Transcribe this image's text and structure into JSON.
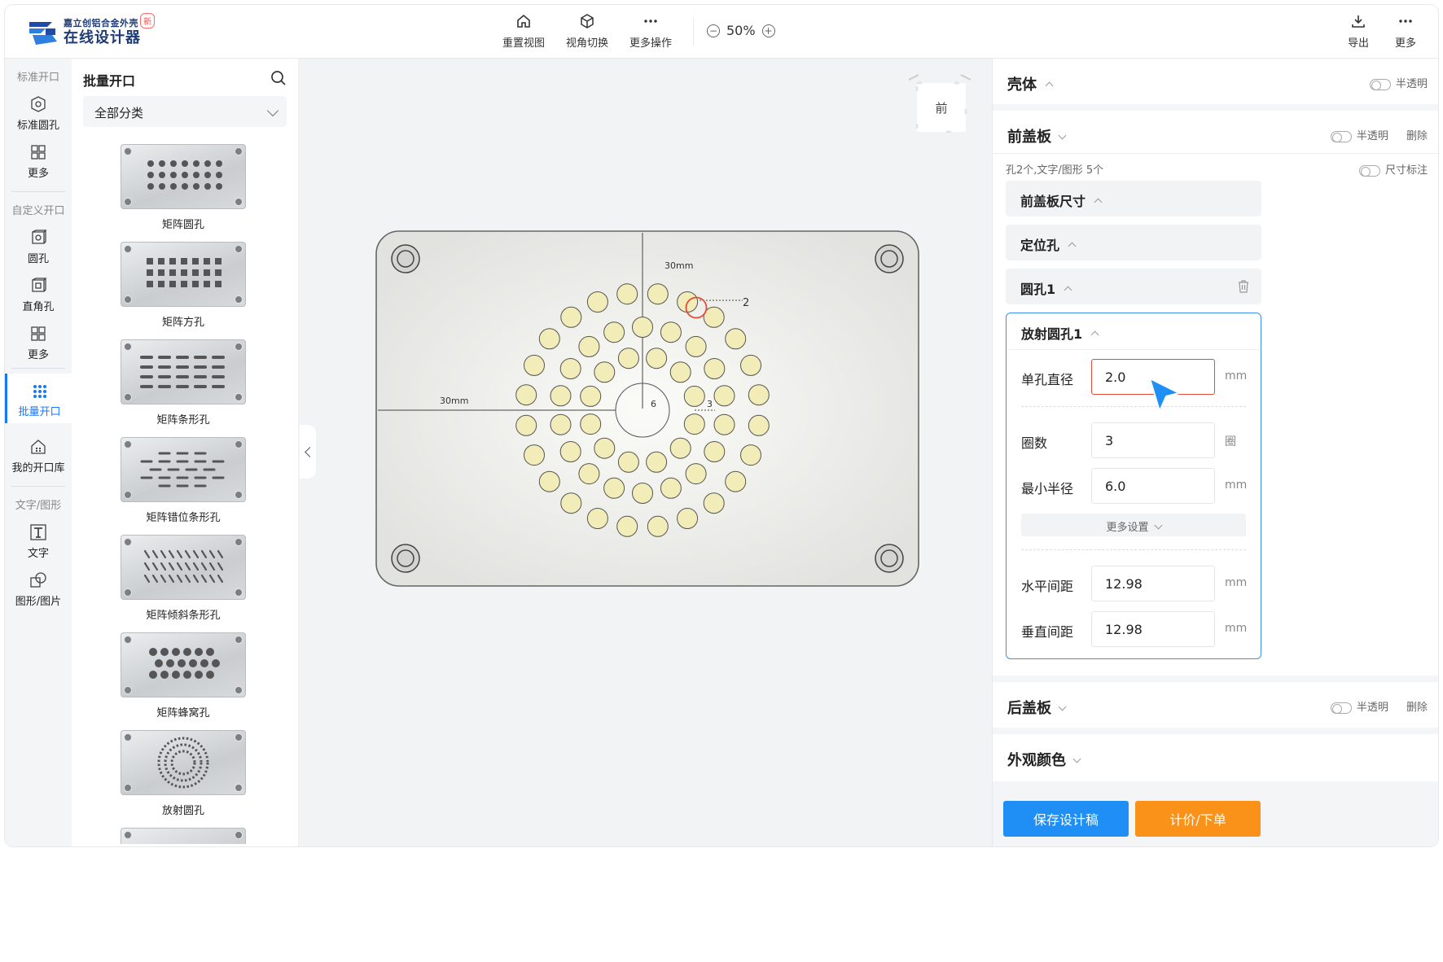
{
  "header": {
    "logo_sub": "嘉立创铝合金外壳",
    "logo_main": "在线设计器",
    "logo_badge": "新",
    "tools": [
      {
        "label": "重置视图",
        "icon": "home-icon"
      },
      {
        "label": "视角切换",
        "icon": "cube-icon"
      },
      {
        "label": "更多操作",
        "icon": "more-dots-icon"
      }
    ],
    "zoom": "50%",
    "right_tools": [
      {
        "label": "导出",
        "icon": "download-icon"
      },
      {
        "label": "更多",
        "icon": "more-dots-icon"
      }
    ]
  },
  "rail": {
    "group1": "标准开口",
    "group1_items": [
      "标准圆孔",
      "更多"
    ],
    "group2": "自定义开口",
    "group2_items": [
      "圆孔",
      "直角孔",
      "更多"
    ],
    "active": "批量开口",
    "library": "我的开口库",
    "group3": "文字/图形",
    "group3_items": [
      "文字",
      "图形/图片"
    ]
  },
  "catalog": {
    "title": "批量开口",
    "category": "全部分类",
    "items": [
      "矩阵圆孔",
      "矩阵方孔",
      "矩阵条形孔",
      "矩阵错位条形孔",
      "矩阵倾斜条形孔",
      "矩阵蜂窝孔",
      "放射圆孔"
    ]
  },
  "canvas": {
    "view_label": "前",
    "dim_top": "30mm",
    "dim_left": "30mm",
    "dim_center": "6",
    "dim_gap": "3",
    "dim_hole": "2",
    "accent_hole": "#f2ecb8",
    "panel_fill": "#e6e6e4"
  },
  "panel": {
    "shell_title": "壳体",
    "translucent": "半透明",
    "front_title": "前盖板",
    "delete": "删除",
    "summary": "孔2个,文字/图形 5个",
    "dim_mark": "尺寸标注",
    "sub_sections": [
      "前盖板尺寸",
      "定位孔",
      "圆孔1"
    ],
    "radial_title": "放射圆孔1",
    "fields": [
      {
        "label": "单孔直径",
        "value": "2.0",
        "unit": "mm"
      },
      {
        "label": "圈数",
        "value": "3",
        "unit": "圈"
      },
      {
        "label": "最小半径",
        "value": "6.0",
        "unit": "mm"
      }
    ],
    "more_settings": "更多设置",
    "fields2": [
      {
        "label": "水平间距",
        "value": "12.98",
        "unit": "mm"
      },
      {
        "label": "垂直间距",
        "value": "12.98",
        "unit": "mm"
      }
    ],
    "back_title": "后盖板",
    "color_title": "外观颜色",
    "save_button": "保存设计稿",
    "order_button": "计价/下单",
    "save_color": "#1f8ff5",
    "order_color": "#fa9118"
  }
}
